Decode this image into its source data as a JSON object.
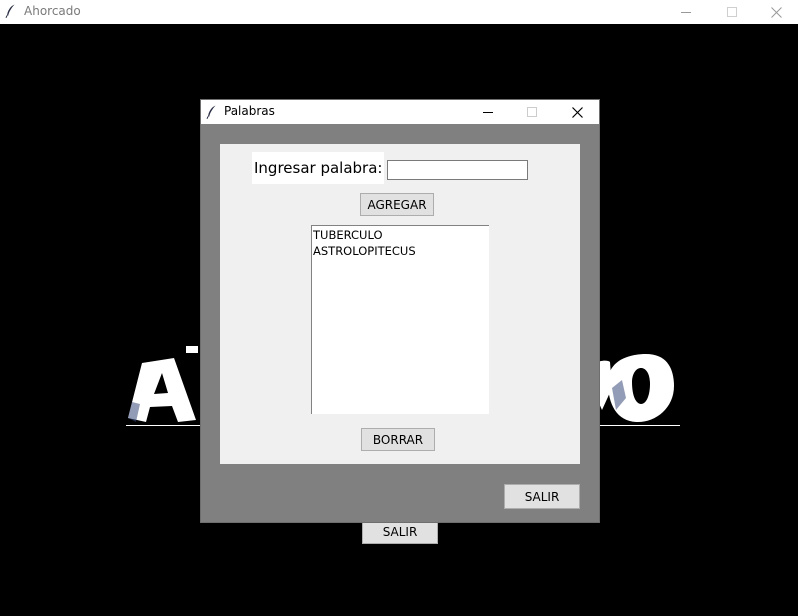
{
  "main_window": {
    "title": "Ahorcado",
    "exit_button_label": "SALIR"
  },
  "dialog": {
    "title": "Palabras",
    "word_label": "Ingresar palabra:",
    "word_input": {
      "value": "",
      "placeholder": ""
    },
    "add_button_label": "AGREGAR",
    "words": [
      "TUBERCULO",
      "ASTROLOPITECUS"
    ],
    "delete_button_label": "BORRAR",
    "exit_button_label": "SALIR"
  },
  "colors": {
    "desktop": "#000000",
    "dialog_frame": "#808080",
    "panel": "#f0f0f0",
    "button_face": "#e1e1e1"
  },
  "icons": [
    "feather-icon",
    "minimize-icon",
    "maximize-icon",
    "close-icon"
  ]
}
